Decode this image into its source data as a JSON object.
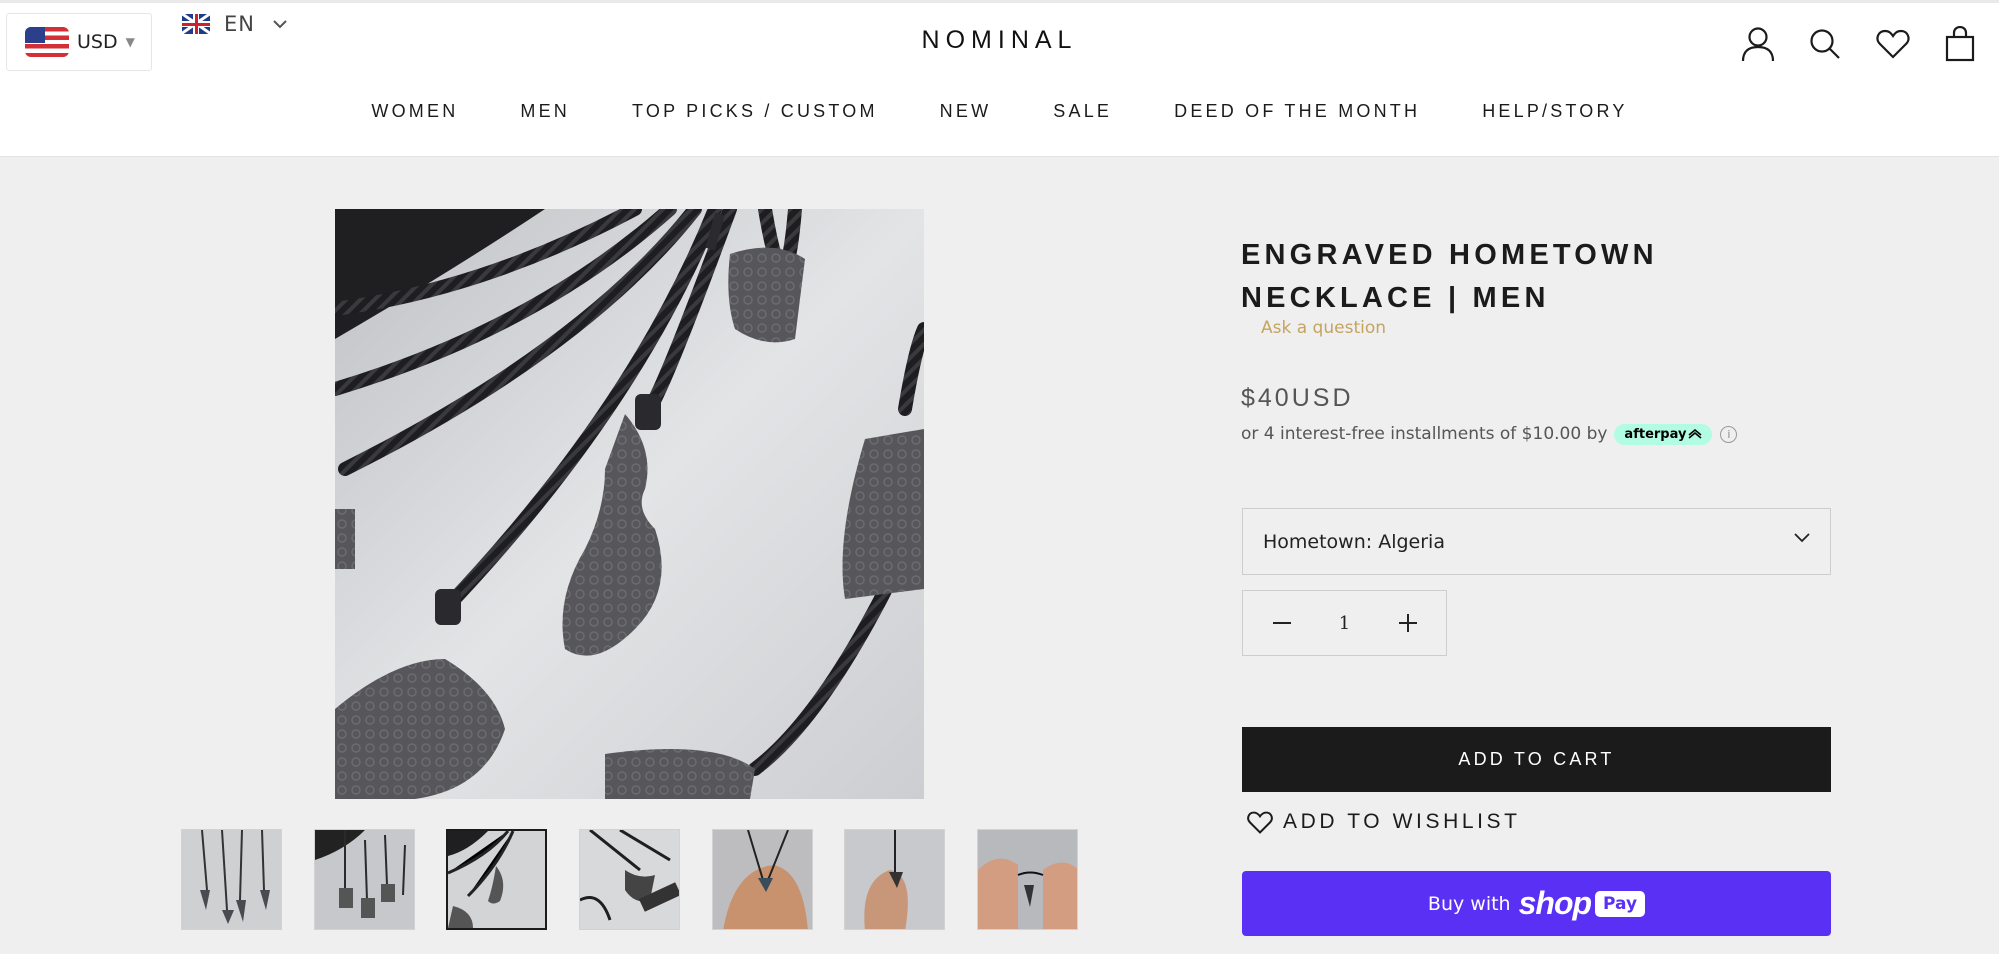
{
  "header": {
    "currency": "USD",
    "language": "EN",
    "logo": "NOMINAL",
    "icons": [
      "account-icon",
      "search-icon",
      "wishlist-heart-icon",
      "cart-bag-icon"
    ]
  },
  "nav": {
    "items": [
      {
        "label": "WOMEN"
      },
      {
        "label": "MEN"
      },
      {
        "label": "TOP PICKS / CUSTOM"
      },
      {
        "label": "NEW"
      },
      {
        "label": "SALE"
      },
      {
        "label": "DEED OF THE MONTH"
      },
      {
        "label": "HELP/STORY"
      }
    ]
  },
  "gallery": {
    "thumbnail_count": 7,
    "active_thumbnail": 3
  },
  "product": {
    "title_line1": "ENGRAVED HOMETOWN",
    "title_line2": "NECKLACE | MEN",
    "ask_question": "Ask a question",
    "price": "$40USD",
    "installments_text": "or 4 interest-free installments of $10.00 by",
    "afterpay_label": "afterpay",
    "info_symbol": "i",
    "variant_label": "Hometown: Algeria",
    "quantity": "1",
    "add_to_cart": "ADD TO CART",
    "add_to_wishlist": "ADD TO WISHLIST",
    "buy_with": "Buy with",
    "shop_word": "shop",
    "pay_word": "Pay"
  },
  "colors": {
    "accent_gold": "#c5a45f",
    "cart_button": "#1c1b1b",
    "shop_pay": "#5a31f4",
    "afterpay_mint": "#b2fce4",
    "page_background": "#efefef"
  }
}
